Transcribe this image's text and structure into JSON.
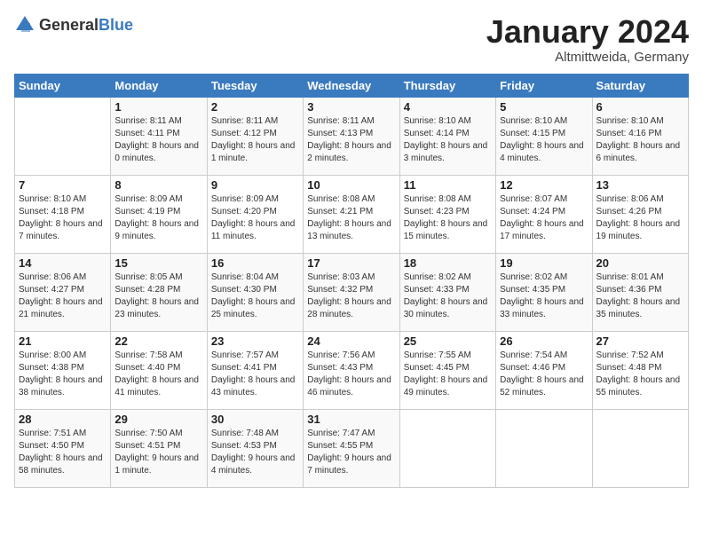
{
  "header": {
    "logo": {
      "general": "General",
      "blue": "Blue"
    },
    "title": "January 2024",
    "location": "Altmittweida, Germany"
  },
  "days_of_week": [
    "Sunday",
    "Monday",
    "Tuesday",
    "Wednesday",
    "Thursday",
    "Friday",
    "Saturday"
  ],
  "weeks": [
    [
      {
        "day": "",
        "sunrise": "",
        "sunset": "",
        "daylight": ""
      },
      {
        "day": "1",
        "sunrise": "Sunrise: 8:11 AM",
        "sunset": "Sunset: 4:11 PM",
        "daylight": "Daylight: 8 hours and 0 minutes."
      },
      {
        "day": "2",
        "sunrise": "Sunrise: 8:11 AM",
        "sunset": "Sunset: 4:12 PM",
        "daylight": "Daylight: 8 hours and 1 minute."
      },
      {
        "day": "3",
        "sunrise": "Sunrise: 8:11 AM",
        "sunset": "Sunset: 4:13 PM",
        "daylight": "Daylight: 8 hours and 2 minutes."
      },
      {
        "day": "4",
        "sunrise": "Sunrise: 8:10 AM",
        "sunset": "Sunset: 4:14 PM",
        "daylight": "Daylight: 8 hours and 3 minutes."
      },
      {
        "day": "5",
        "sunrise": "Sunrise: 8:10 AM",
        "sunset": "Sunset: 4:15 PM",
        "daylight": "Daylight: 8 hours and 4 minutes."
      },
      {
        "day": "6",
        "sunrise": "Sunrise: 8:10 AM",
        "sunset": "Sunset: 4:16 PM",
        "daylight": "Daylight: 8 hours and 6 minutes."
      }
    ],
    [
      {
        "day": "7",
        "sunrise": "Sunrise: 8:10 AM",
        "sunset": "Sunset: 4:18 PM",
        "daylight": "Daylight: 8 hours and 7 minutes."
      },
      {
        "day": "8",
        "sunrise": "Sunrise: 8:09 AM",
        "sunset": "Sunset: 4:19 PM",
        "daylight": "Daylight: 8 hours and 9 minutes."
      },
      {
        "day": "9",
        "sunrise": "Sunrise: 8:09 AM",
        "sunset": "Sunset: 4:20 PM",
        "daylight": "Daylight: 8 hours and 11 minutes."
      },
      {
        "day": "10",
        "sunrise": "Sunrise: 8:08 AM",
        "sunset": "Sunset: 4:21 PM",
        "daylight": "Daylight: 8 hours and 13 minutes."
      },
      {
        "day": "11",
        "sunrise": "Sunrise: 8:08 AM",
        "sunset": "Sunset: 4:23 PM",
        "daylight": "Daylight: 8 hours and 15 minutes."
      },
      {
        "day": "12",
        "sunrise": "Sunrise: 8:07 AM",
        "sunset": "Sunset: 4:24 PM",
        "daylight": "Daylight: 8 hours and 17 minutes."
      },
      {
        "day": "13",
        "sunrise": "Sunrise: 8:06 AM",
        "sunset": "Sunset: 4:26 PM",
        "daylight": "Daylight: 8 hours and 19 minutes."
      }
    ],
    [
      {
        "day": "14",
        "sunrise": "Sunrise: 8:06 AM",
        "sunset": "Sunset: 4:27 PM",
        "daylight": "Daylight: 8 hours and 21 minutes."
      },
      {
        "day": "15",
        "sunrise": "Sunrise: 8:05 AM",
        "sunset": "Sunset: 4:28 PM",
        "daylight": "Daylight: 8 hours and 23 minutes."
      },
      {
        "day": "16",
        "sunrise": "Sunrise: 8:04 AM",
        "sunset": "Sunset: 4:30 PM",
        "daylight": "Daylight: 8 hours and 25 minutes."
      },
      {
        "day": "17",
        "sunrise": "Sunrise: 8:03 AM",
        "sunset": "Sunset: 4:32 PM",
        "daylight": "Daylight: 8 hours and 28 minutes."
      },
      {
        "day": "18",
        "sunrise": "Sunrise: 8:02 AM",
        "sunset": "Sunset: 4:33 PM",
        "daylight": "Daylight: 8 hours and 30 minutes."
      },
      {
        "day": "19",
        "sunrise": "Sunrise: 8:02 AM",
        "sunset": "Sunset: 4:35 PM",
        "daylight": "Daylight: 8 hours and 33 minutes."
      },
      {
        "day": "20",
        "sunrise": "Sunrise: 8:01 AM",
        "sunset": "Sunset: 4:36 PM",
        "daylight": "Daylight: 8 hours and 35 minutes."
      }
    ],
    [
      {
        "day": "21",
        "sunrise": "Sunrise: 8:00 AM",
        "sunset": "Sunset: 4:38 PM",
        "daylight": "Daylight: 8 hours and 38 minutes."
      },
      {
        "day": "22",
        "sunrise": "Sunrise: 7:58 AM",
        "sunset": "Sunset: 4:40 PM",
        "daylight": "Daylight: 8 hours and 41 minutes."
      },
      {
        "day": "23",
        "sunrise": "Sunrise: 7:57 AM",
        "sunset": "Sunset: 4:41 PM",
        "daylight": "Daylight: 8 hours and 43 minutes."
      },
      {
        "day": "24",
        "sunrise": "Sunrise: 7:56 AM",
        "sunset": "Sunset: 4:43 PM",
        "daylight": "Daylight: 8 hours and 46 minutes."
      },
      {
        "day": "25",
        "sunrise": "Sunrise: 7:55 AM",
        "sunset": "Sunset: 4:45 PM",
        "daylight": "Daylight: 8 hours and 49 minutes."
      },
      {
        "day": "26",
        "sunrise": "Sunrise: 7:54 AM",
        "sunset": "Sunset: 4:46 PM",
        "daylight": "Daylight: 8 hours and 52 minutes."
      },
      {
        "day": "27",
        "sunrise": "Sunrise: 7:52 AM",
        "sunset": "Sunset: 4:48 PM",
        "daylight": "Daylight: 8 hours and 55 minutes."
      }
    ],
    [
      {
        "day": "28",
        "sunrise": "Sunrise: 7:51 AM",
        "sunset": "Sunset: 4:50 PM",
        "daylight": "Daylight: 8 hours and 58 minutes."
      },
      {
        "day": "29",
        "sunrise": "Sunrise: 7:50 AM",
        "sunset": "Sunset: 4:51 PM",
        "daylight": "Daylight: 9 hours and 1 minute."
      },
      {
        "day": "30",
        "sunrise": "Sunrise: 7:48 AM",
        "sunset": "Sunset: 4:53 PM",
        "daylight": "Daylight: 9 hours and 4 minutes."
      },
      {
        "day": "31",
        "sunrise": "Sunrise: 7:47 AM",
        "sunset": "Sunset: 4:55 PM",
        "daylight": "Daylight: 9 hours and 7 minutes."
      },
      {
        "day": "",
        "sunrise": "",
        "sunset": "",
        "daylight": ""
      },
      {
        "day": "",
        "sunrise": "",
        "sunset": "",
        "daylight": ""
      },
      {
        "day": "",
        "sunrise": "",
        "sunset": "",
        "daylight": ""
      }
    ]
  ]
}
